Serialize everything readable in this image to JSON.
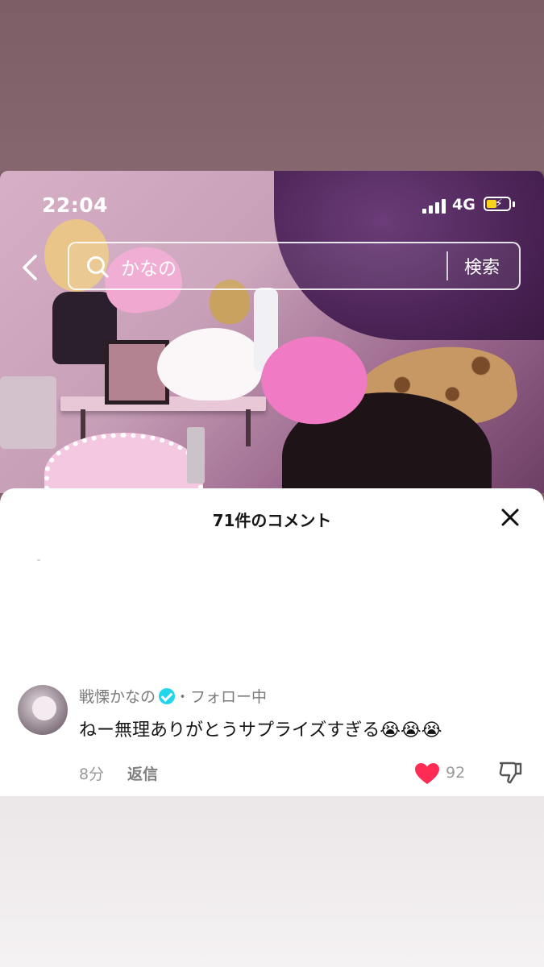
{
  "status_bar": {
    "time": "22:04",
    "network": "4G",
    "battery_level": 0.45,
    "battery_color": "#f6d21a"
  },
  "search": {
    "query": "かなの",
    "button_label": "検索"
  },
  "comments_sheet": {
    "title": "71件のコメント",
    "comment": {
      "username": "戦慄かなの",
      "follow_status": "・フォロー中",
      "text": "ねー無理ありがとうサプライズすぎる😭😭😭",
      "time_ago": "8分",
      "reply_label": "返信",
      "likes": "92"
    }
  },
  "colors": {
    "accent_blue": "#20d5ec",
    "like_red": "#fe2c55"
  },
  "icons": [
    "back-icon",
    "search-icon",
    "close-icon",
    "verified-icon",
    "heart-icon",
    "dislike-icon"
  ]
}
